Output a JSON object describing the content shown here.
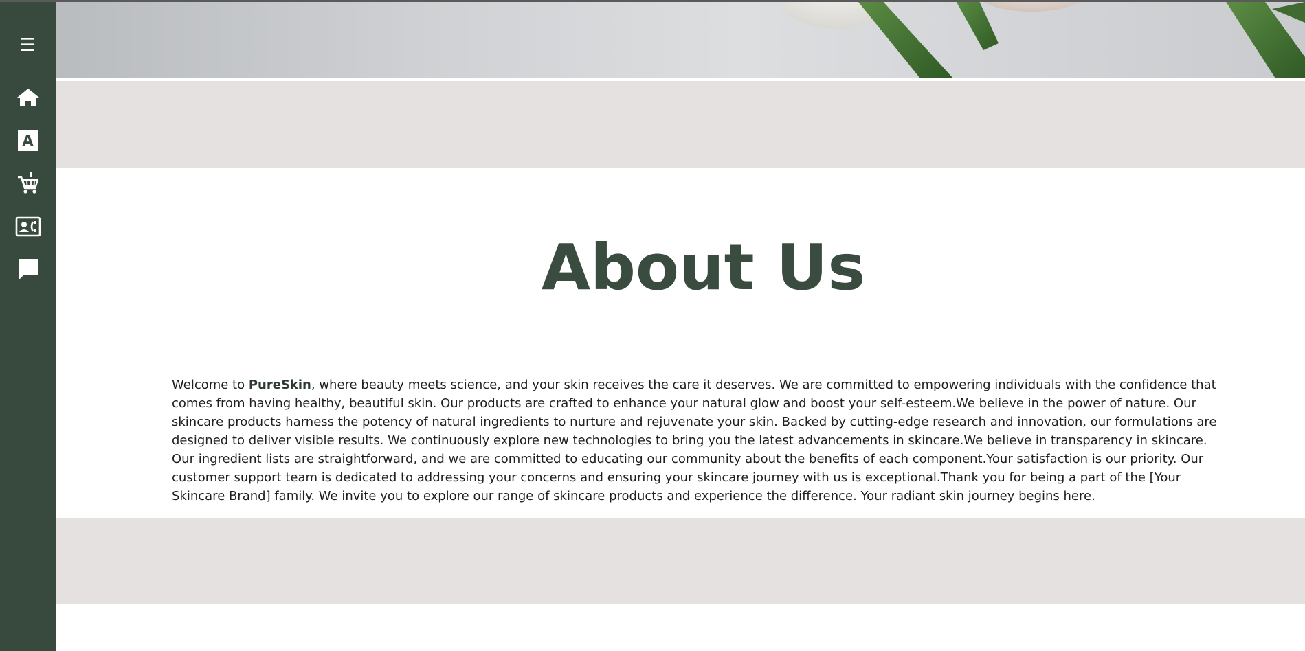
{
  "sidebar": {
    "items": [
      {
        "icon": "menu-icon",
        "label": "☰"
      },
      {
        "icon": "home-icon"
      },
      {
        "icon": "font-a-icon",
        "label": "A"
      },
      {
        "icon": "cart-icon"
      },
      {
        "icon": "contact-card-icon"
      },
      {
        "icon": "chat-bubble-icon"
      }
    ]
  },
  "colors": {
    "sidebar_bg": "#384a3d",
    "title": "#394c3f",
    "band_bg": "#e5e1e0",
    "text": "#1f1f1f"
  },
  "about": {
    "title": "About Us",
    "intro_prefix": "Welcome to ",
    "brand_name": "PureSkin",
    "intro_body": ", where beauty meets science, and your skin receives the care it deserves. We are committed to empowering individuals with the confidence that comes from having healthy, beautiful skin. Our products are crafted to enhance your natural glow and boost your self-esteem.We believe in the power of nature. Our skincare products harness the potency of natural ingredients to nurture and rejuvenate your skin. Backed by cutting-edge research and innovation, our formulations are designed to deliver visible results. We continuously explore new technologies to bring you the latest advancements in skincare.We believe in transparency in skincare. Our ingredient lists are straightforward, and we are committed to educating our community about the benefits of each component.Your satisfaction is our priority. Our customer support team is dedicated to addressing your concerns and ensuring your skincare journey with us is exceptional.Thank you for being a part of the [Your Skincare Brand] family. We invite you to explore our range of skincare products and experience the difference. Your radiant skin journey begins here."
  }
}
